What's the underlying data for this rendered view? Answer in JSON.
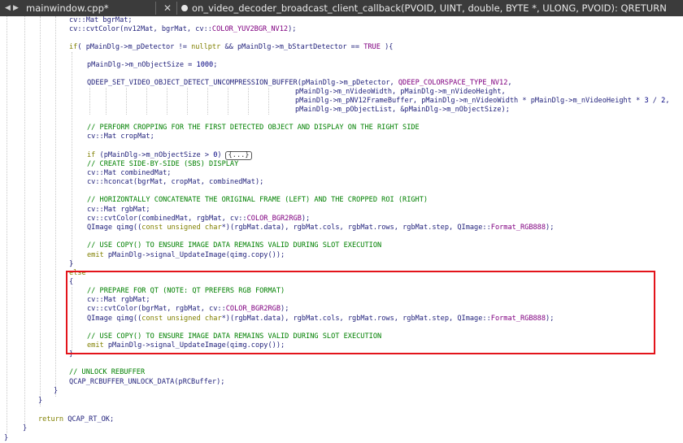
{
  "tabs": {
    "file_name": "mainwindow.cpp*",
    "function_signature": "on_video_decoder_broadcast_client_callback(PVOID, UINT, double, BYTE *, ULONG, PVOID): QRETURN",
    "close_glyph": "✕"
  },
  "code_lines": [
    {
      "text": "cv::Mat bgrMat;"
    },
    {
      "text": "cv::cvtColor(nv12Mat, bgrMat, cv::COLOR_YUV2BGR_NV12);"
    },
    {
      "text": ""
    },
    {
      "text": "if( pMainDlg->m_pDetector != nullptr && pMainDlg->m_bStartDetector == TRUE ){"
    },
    {
      "text": ""
    },
    {
      "text": "pMainDlg->m_nObjectSize = 1000;"
    },
    {
      "text": ""
    },
    {
      "text": "QDEEP_SET_VIDEO_OBJECT_DETECT_UNCOMPRESSION_BUFFER(pMainDlg->m_pDetector, QDEEP_COLORSPACE_TYPE_NV12,"
    },
    {
      "text": "pMainDlg->m_nVideoWidth, pMainDlg->m_nVideoHeight,"
    },
    {
      "text": "pMainDlg->m_pNV12FrameBuffer, pMainDlg->m_nVideoWidth * pMainDlg->m_nVideoHeight * 3 / 2,"
    },
    {
      "text": "pMainDlg->m_pObjectList, &pMainDlg->m_nObjectSize);"
    },
    {
      "text": ""
    },
    {
      "text": "// PERFORM CROPPING FOR THE FIRST DETECTED OBJECT AND DISPLAY ON THE RIGHT SIDE"
    },
    {
      "text": "cv::Mat cropMat;"
    },
    {
      "text": ""
    },
    {
      "text": "if (pMainDlg->m_nObjectSize > 0)",
      "fold": "{...}"
    },
    {
      "text": "// CREATE SIDE-BY-SIDE (SBS) DISPLAY"
    },
    {
      "text": "cv::Mat combinedMat;"
    },
    {
      "text": "cv::hconcat(bgrMat, cropMat, combinedMat);"
    },
    {
      "text": ""
    },
    {
      "text": "// HORIZONTALLY CONCATENATE THE ORIGINAL FRAME (LEFT) AND THE CROPPED ROI (RIGHT)"
    },
    {
      "text": "cv::Mat rgbMat;"
    },
    {
      "text": "cv::cvtColor(combinedMat, rgbMat, cv::COLOR_BGR2RGB);"
    },
    {
      "text": "QImage qimg((const unsigned char*)(rgbMat.data), rgbMat.cols, rgbMat.rows, rgbMat.step, QImage::Format_RGB888);"
    },
    {
      "text": ""
    },
    {
      "text": "// USE COPY() TO ENSURE IMAGE DATA REMAINS VALID DURING SLOT EXECUTION"
    },
    {
      "text": "emit pMainDlg->signal_UpdateImage(qimg.copy());"
    },
    {
      "text": "}"
    },
    {
      "text": "else"
    },
    {
      "text": "{"
    },
    {
      "text": "// PREPARE FOR QT (NOTE: QT PREFERS RGB FORMAT)"
    },
    {
      "text": "cv::Mat rgbMat;"
    },
    {
      "text": "cv::cvtColor(bgrMat, rgbMat, cv::COLOR_BGR2RGB);"
    },
    {
      "text": "QImage qimg((const unsigned char*)(rgbMat.data), rgbMat.cols, rgbMat.rows, rgbMat.step, QImage::Format_RGB888);"
    },
    {
      "text": ""
    },
    {
      "text": "// USE COPY() TO ENSURE IMAGE DATA REMAINS VALID DURING SLOT EXECUTION"
    },
    {
      "text": "emit pMainDlg->signal_UpdateImage(qimg.copy());"
    },
    {
      "text": "}"
    },
    {
      "text": ""
    },
    {
      "text": "// UNLOCK REBUFFER"
    },
    {
      "text": "QCAP_RCBUFFER_UNLOCK_DATA(pRCBuffer);"
    },
    {
      "text": "}"
    },
    {
      "text": "}"
    },
    {
      "text": ""
    },
    {
      "text": "return QCAP_RT_OK;"
    },
    {
      "text": "}"
    },
    {
      "text": "}"
    }
  ],
  "colors": {
    "keyword": "#808000",
    "number": "#000080",
    "comment": "#008000",
    "type": "#800080",
    "identifier": "#1f1f7a",
    "highlight_border": "#e3141b",
    "tab_bar": "#3b3b3b"
  }
}
